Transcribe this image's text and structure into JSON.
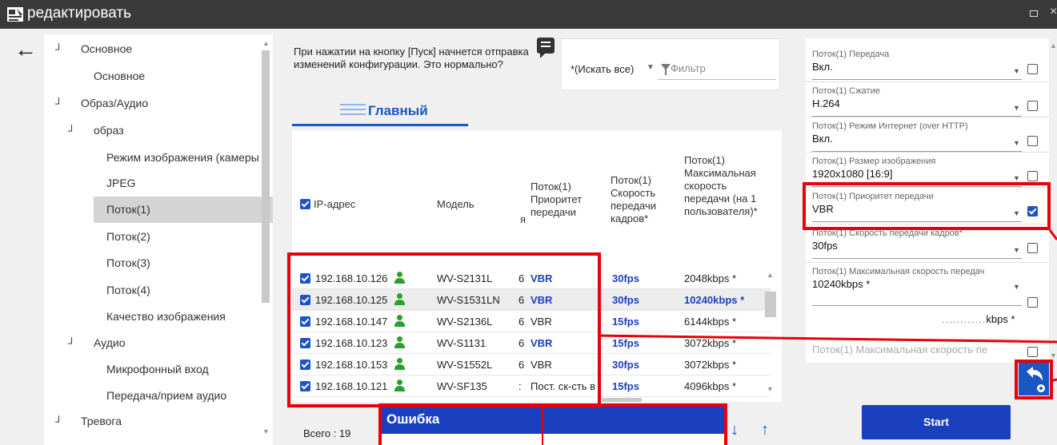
{
  "window": {
    "title": "редактировать"
  },
  "tree": {
    "items": [
      {
        "label": "Основное",
        "expanded": true
      },
      {
        "label": "Основное"
      },
      {
        "label": "Образ/Аудио",
        "expanded": true
      },
      {
        "label": "образ",
        "expanded": true
      },
      {
        "label": "Режим изображения (камеры"
      },
      {
        "label": "JPEG"
      },
      {
        "label": "Поток(1)",
        "selected": true
      },
      {
        "label": "Поток(2)"
      },
      {
        "label": "Поток(3)"
      },
      {
        "label": "Поток(4)"
      },
      {
        "label": "Качество изображения"
      },
      {
        "label": "Аудио",
        "expanded": true
      },
      {
        "label": "Микрофонный вход"
      },
      {
        "label": "Передача/прием аудио"
      },
      {
        "label": "Тревога",
        "expanded": true
      }
    ]
  },
  "info": {
    "text": "При нажатии на кнопку [Пуск] начнется отправка изменений конфигурации. Это нормально?"
  },
  "search": {
    "scope": "*(Искать все)",
    "filter_placeholder": "Фильтр"
  },
  "tab": {
    "label": "Главный"
  },
  "table": {
    "headers": {
      "ip": "IP-адрес",
      "model": "Модель",
      "hidden": "я",
      "priority": "Поток(1) Приоритет передачи",
      "framerate": "Поток(1) Скорость передачи кадров*",
      "maxbitrate": "Поток(1) Максимальная скорость передачи (на 1 пользователя)*"
    },
    "rows": [
      {
        "ip": "192.168.10.126",
        "model": "WV-S2131L",
        "c": "6",
        "priority": "VBR",
        "priority_bold": true,
        "fps": "30fps",
        "max": "2048kbps *",
        "max_bold": false
      },
      {
        "ip": "192.168.10.125",
        "model": "WV-S1531LN",
        "c": "6",
        "priority": "VBR",
        "priority_bold": true,
        "fps": "30fps",
        "max": "10240kbps *",
        "max_bold": true
      },
      {
        "ip": "192.168.10.147",
        "model": "WV-S2136L",
        "c": "6",
        "priority": "VBR",
        "priority_bold": false,
        "fps": "15fps",
        "max": "6144kbps *",
        "max_bold": false
      },
      {
        "ip": "192.168.10.123",
        "model": "WV-S1131",
        "c": "6",
        "priority": "VBR",
        "priority_bold": true,
        "fps": "15fps",
        "max": "3072kbps *",
        "max_bold": false
      },
      {
        "ip": "192.168.10.153",
        "model": "WV-S1552L",
        "c": "6",
        "priority": "VBR",
        "priority_bold": false,
        "fps": "30fps",
        "max": "3072kbps *",
        "max_bold": false
      },
      {
        "ip": "192.168.10.121",
        "model": "WV-SF135",
        "c": ":",
        "priority": "Пост. ск-сть в",
        "priority_bold": false,
        "fps": "15fps",
        "max": "4096kbps *",
        "max_bold": false
      }
    ]
  },
  "footer": {
    "total": "Всего : 19"
  },
  "error": {
    "title": "Ошибка"
  },
  "props": [
    {
      "label": "Поток(1) Передача",
      "value": "Вкл.",
      "checked": false
    },
    {
      "label": "Поток(1) Сжатие",
      "value": "H.264",
      "checked": false
    },
    {
      "label": "Поток(1) Режим Интернет (over HTTP)",
      "value": "Вкл.",
      "checked": false
    },
    {
      "label": "Поток(1) Размер изображения",
      "value": "1920x1080 [16:9]",
      "checked": false
    },
    {
      "label": "Поток(1) Приоритет передачи",
      "value": "VBR",
      "checked": true
    },
    {
      "label": "Поток(1) Скорость передачи кадров*",
      "value": "30fps",
      "checked": false
    },
    {
      "label": "Поток(1) Максимальная скорость передач",
      "value": "10240kbps *",
      "checked": false
    },
    {
      "label": "Поток(1) Максимальная скорость пе",
      "value": "",
      "checked": false
    }
  ],
  "kbps_suffix": "kbps *",
  "start_button": {
    "label": "Start"
  },
  "colors": {
    "accent": "#1a56c4",
    "dark_blue": "#1a3fbf",
    "highlight_red": "#e8000b",
    "titlebar": "#3a3a3a"
  },
  "icons": [
    "app-icon",
    "back-arrow-icon",
    "chat-icon",
    "filter-icon",
    "list-icon",
    "person-icon",
    "undo-settings-icon"
  ]
}
